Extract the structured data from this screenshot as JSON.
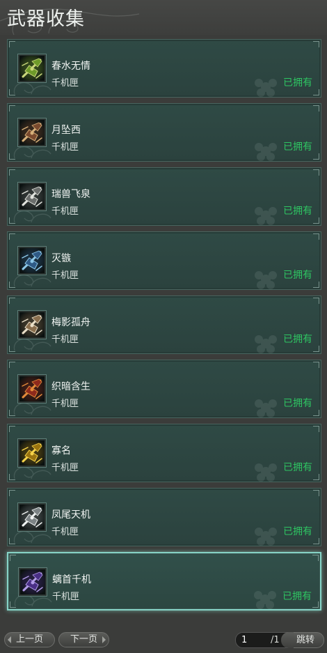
{
  "header": {
    "title": "武器收集"
  },
  "weapons": [
    {
      "name": "春水无情",
      "category": "千机匣",
      "status": "已拥有",
      "icon": "green-crossbow-icon",
      "colors": [
        "#6e9a2a",
        "#c9d77a"
      ]
    },
    {
      "name": "月坠西",
      "category": "千机匣",
      "status": "已拥有",
      "icon": "bronze-crossbow-icon",
      "colors": [
        "#7a4a2e",
        "#d7b07a"
      ]
    },
    {
      "name": "瑞兽飞泉",
      "category": "千机匣",
      "status": "已拥有",
      "icon": "silver-crossbow-icon",
      "colors": [
        "#6b6e6c",
        "#e2e4de"
      ]
    },
    {
      "name": "灭镞",
      "category": "千机匣",
      "status": "已拥有",
      "icon": "blue-crossbow-icon",
      "colors": [
        "#2f5a86",
        "#8cc7e8"
      ]
    },
    {
      "name": "梅影孤舟",
      "category": "千机匣",
      "status": "已拥有",
      "icon": "ivory-crossbow-icon",
      "colors": [
        "#8a6f4e",
        "#eadfc8"
      ]
    },
    {
      "name": "织暗含生",
      "category": "千机匣",
      "status": "已拥有",
      "icon": "red-crossbow-icon",
      "colors": [
        "#8e2a1c",
        "#e28a3a"
      ]
    },
    {
      "name": "寡名",
      "category": "千机匣",
      "status": "已拥有",
      "icon": "golden-crossbow-icon",
      "colors": [
        "#9a7410",
        "#f5d34a"
      ]
    },
    {
      "name": "凤尾天机",
      "category": "千机匣",
      "status": "已拥有",
      "icon": "steel-crossbow-icon",
      "colors": [
        "#7d8486",
        "#f0f3f2"
      ]
    },
    {
      "name": "螭首千机",
      "category": "千机匣",
      "status": "已拥有",
      "icon": "violet-crossbow-icon",
      "colors": [
        "#4a2f86",
        "#b29be8"
      ]
    }
  ],
  "selected_index": 8,
  "pagination": {
    "prev_label": "上一页",
    "next_label": "下一页",
    "current_page": "1",
    "total_pages": "/1",
    "jump_label": "跳转"
  },
  "colors": {
    "background": "#3b3c3a",
    "card": "#2f4a45",
    "owned_status": "#2ec562",
    "selected_border": "#86d3c6"
  }
}
